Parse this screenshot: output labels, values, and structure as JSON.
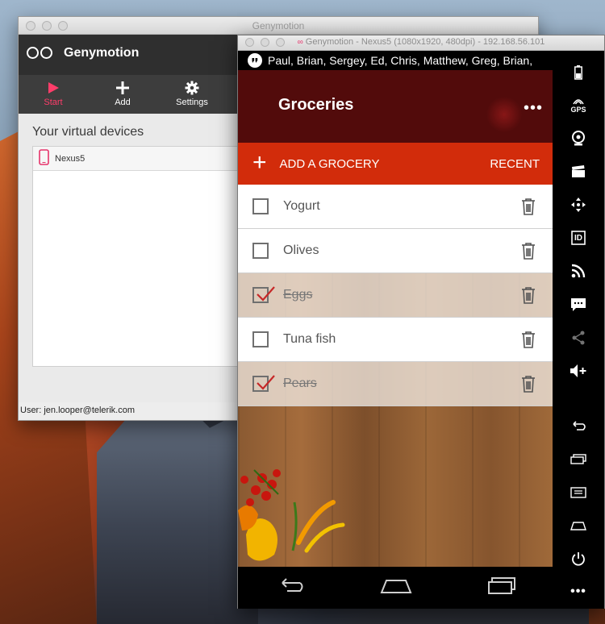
{
  "launcher": {
    "window_title": "Genymotion",
    "app_name": "Genymotion",
    "toolbar": [
      {
        "label": "Start",
        "icon": "play-icon",
        "active": true
      },
      {
        "label": "Add",
        "icon": "plus-icon",
        "active": false
      },
      {
        "label": "Settings",
        "icon": "gear-icon",
        "active": false
      }
    ],
    "devices_title": "Your virtual devices",
    "devices": [
      {
        "name": "Nexus5",
        "icon": "phone-icon"
      }
    ],
    "status_user": "User: jen.looper@telerik.com"
  },
  "emulator": {
    "window_title": "Genymotion - Nexus5 (1080x1920, 480dpi) - 192.168.56.101",
    "notification_text": "Paul, Brian, Sergey, Ed, Chris, Matthew, Greg, Brian,",
    "app_title": "Groceries",
    "add_label": "ADD A GROCERY",
    "recent_label": "RECENT",
    "items": [
      {
        "label": "Yogurt",
        "done": false
      },
      {
        "label": "Olives",
        "done": false
      },
      {
        "label": "Eggs",
        "done": true
      },
      {
        "label": "Tuna fish",
        "done": false
      },
      {
        "label": "Pears",
        "done": true
      }
    ],
    "sidebar_gps_label": "GPS",
    "sidebar_id_label": "ID",
    "sidebar_icons": [
      "battery-icon",
      "gps-icon",
      "webcam-icon",
      "clapper-icon",
      "dpad-icon",
      "id-icon",
      "rss-icon",
      "sms-icon",
      "share-icon",
      "volume-up-icon",
      "back-icon",
      "recent-apps-icon",
      "menu-icon",
      "home-icon",
      "power-icon",
      "more-icon"
    ]
  },
  "colors": {
    "accent_red": "#d22c0b",
    "start_active": "#ff3d6a",
    "checkmark": "#c62828"
  }
}
